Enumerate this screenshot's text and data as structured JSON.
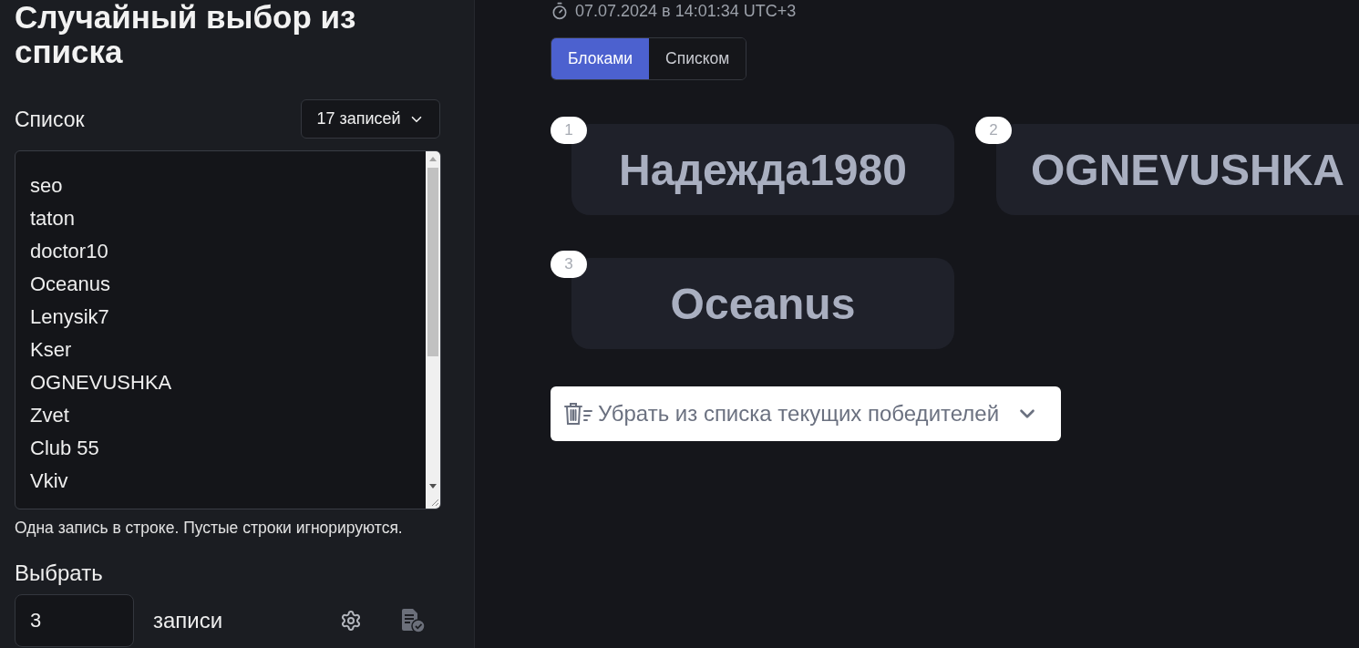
{
  "sidebar": {
    "title": "Случайный выбор из списка",
    "list_label": "Список",
    "count_dropdown": "17 записей",
    "entries": [
      "seo",
      "taton",
      "doctor10",
      "Oceanus",
      "Lenysik7",
      "Kser",
      "OGNEVUSHKA",
      "Zvet",
      "Club 55",
      "Vkiv"
    ],
    "hint": "Одна запись в строке. Пустые строки игнорируются.",
    "pick_label": "Выбрать",
    "pick_count": {
      "value": "3"
    },
    "pick_unit": "записи"
  },
  "results": {
    "timestamp": "07.07.2024 в 14:01:34 UTC+3",
    "view_tabs": [
      {
        "label": "Блоками",
        "selected": true
      },
      {
        "label": "Списком",
        "selected": false
      }
    ],
    "winners": [
      {
        "number": "1",
        "name": "Надежда1980"
      },
      {
        "number": "2",
        "name": "OGNEVUSHKA"
      },
      {
        "number": "3",
        "name": "Oceanus"
      }
    ],
    "remove_button": "Убрать из списка текущих победителей"
  }
}
